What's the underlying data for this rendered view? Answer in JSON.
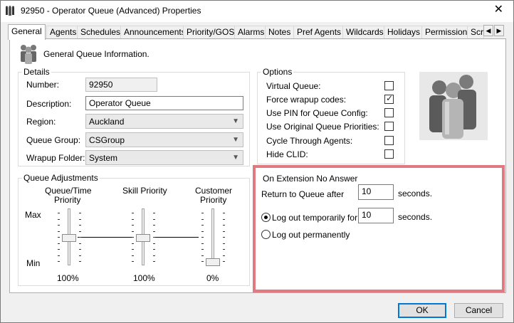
{
  "window": {
    "title": "92950 - Operator Queue (Advanced) Properties",
    "close_glyph": "✕"
  },
  "tabs": [
    "General",
    "Agents",
    "Schedules",
    "Announcements",
    "Priority/GOS",
    "Alarms",
    "Notes",
    "Pref Agents",
    "Wildcards",
    "Holidays",
    "Permissions",
    "Scr"
  ],
  "active_tab": "General",
  "header": {
    "text": "General Queue Information."
  },
  "details": {
    "title": "Details",
    "number_label": "Number:",
    "number_value": "92950",
    "description_label": "Description:",
    "description_value": "Operator Queue",
    "region_label": "Region:",
    "region_value": "Auckland",
    "queue_group_label": "Queue Group:",
    "queue_group_value": "CSGroup",
    "wrapup_label": "Wrapup Folder:",
    "wrapup_value": "System"
  },
  "options": {
    "title": "Options",
    "items": [
      {
        "label": "Virtual Queue:",
        "checked": false
      },
      {
        "label": "Force wrapup codes:",
        "checked": true
      },
      {
        "label": "Use PIN for Queue Config:",
        "checked": false
      },
      {
        "label": "Use Original Queue Priorities:",
        "checked": false
      },
      {
        "label": "Cycle Through Agents:",
        "checked": false
      },
      {
        "label": "Hide CLID:",
        "checked": false
      }
    ]
  },
  "adjustments": {
    "title": "Queue Adjustments",
    "max_label": "Max",
    "min_label": "Min",
    "sliders": [
      {
        "label_line1": "Queue/Time",
        "label_line2": "Priority",
        "value": "100%",
        "level": 0.5
      },
      {
        "label_line1": "Skill Priority",
        "label_line2": "",
        "value": "100%",
        "level": 0.5
      },
      {
        "label_line1": "Customer",
        "label_line2": "Priority",
        "value": "0%",
        "level": 0.0
      }
    ]
  },
  "no_answer": {
    "title": "On Extension No Answer",
    "return_label": "Return to Queue after",
    "return_value": "10",
    "return_unit": "seconds.",
    "logout_temp_label": "Log out temporarily for",
    "logout_temp_value": "10",
    "logout_temp_unit": "seconds.",
    "logout_perm_label": "Log out permanently",
    "selected": "temporary"
  },
  "buttons": {
    "ok": "OK",
    "cancel": "Cancel"
  },
  "colors": {
    "highlight_border": "#e07a80",
    "default_button_border": "#0078d7"
  }
}
